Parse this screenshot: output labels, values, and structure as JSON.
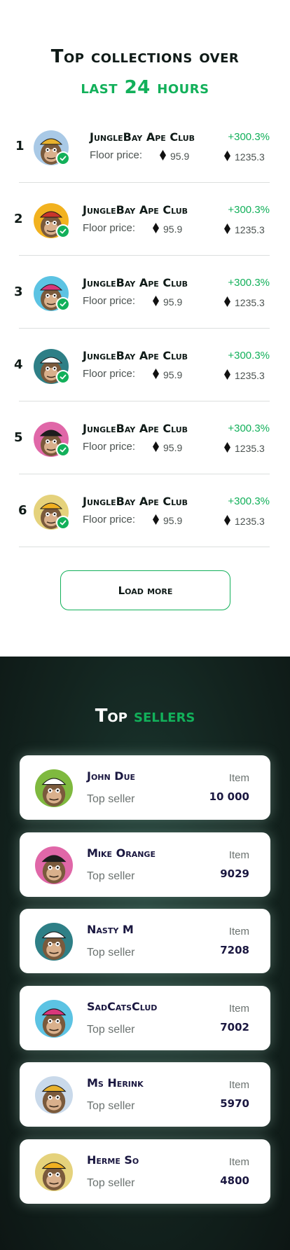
{
  "collections": {
    "title_line1": "Top collections over",
    "title_line2": "last 24 hours",
    "floor_label": "Floor price:",
    "rows": [
      {
        "rank": "1",
        "name": "JungleBay Ape Club",
        "floor_price": "95.9",
        "volume": "1235.3",
        "change": "+300.3%",
        "avatar_bg": "#a9c9e6",
        "hat_color": "#e8b22e"
      },
      {
        "rank": "2",
        "name": "JungleBay Ape Club",
        "floor_price": "95.9",
        "volume": "1235.3",
        "change": "+300.3%",
        "avatar_bg": "#f2b21f",
        "hat_color": "#c8352b"
      },
      {
        "rank": "3",
        "name": "JungleBay Ape Club",
        "floor_price": "95.9",
        "volume": "1235.3",
        "change": "+300.3%",
        "avatar_bg": "#5cc3e3",
        "hat_color": "#d8377a"
      },
      {
        "rank": "4",
        "name": "JungleBay Ape Club",
        "floor_price": "95.9",
        "volume": "1235.3",
        "change": "+300.3%",
        "avatar_bg": "#2e7f86",
        "hat_color": "#ffffff"
      },
      {
        "rank": "5",
        "name": "JungleBay Ape Club",
        "floor_price": "95.9",
        "volume": "1235.3",
        "change": "+300.3%",
        "avatar_bg": "#e067a8",
        "hat_color": "#1d1d1d"
      },
      {
        "rank": "6",
        "name": "JungleBay Ape Club",
        "floor_price": "95.9",
        "volume": "1235.3",
        "change": "+300.3%",
        "avatar_bg": "#e5d27c",
        "hat_color": "#f0b021"
      }
    ],
    "load_more_label": "Load more"
  },
  "sellers": {
    "title_part1": "Top",
    "title_part2": "sellers",
    "item_label": "Item",
    "rows": [
      {
        "name": "John Due",
        "subtitle": "Top seller",
        "items": "10 000",
        "avatar_bg": "#7fb93f",
        "hat_color": "#ffffff"
      },
      {
        "name": "Mike Orange",
        "subtitle": "Top seller",
        "items": "9029",
        "avatar_bg": "#e067a8",
        "hat_color": "#1d1d1d"
      },
      {
        "name": "Nasty M",
        "subtitle": "Top seller",
        "items": "7208",
        "avatar_bg": "#2e7f86",
        "hat_color": "#ffffff"
      },
      {
        "name": "SadCatsClud",
        "subtitle": "Top seller",
        "items": "7002",
        "avatar_bg": "#5cc3e3",
        "hat_color": "#d8377a"
      },
      {
        "name": "Ms Herink",
        "subtitle": "Top seller",
        "items": "5970",
        "avatar_bg": "#c9d9ea",
        "hat_color": "#e8b22e"
      },
      {
        "name": "Herme So",
        "subtitle": "Top seller",
        "items": "4800",
        "avatar_bg": "#e5d27c",
        "hat_color": "#f0b021"
      }
    ]
  },
  "colors": {
    "accent": "#12b05a",
    "dark_bg": "#13241f",
    "heading": "#0f1a17",
    "seller_name": "#1a1740"
  },
  "icons": {
    "verified": "check-badge-icon",
    "currency": "eth-diamond-icon"
  }
}
